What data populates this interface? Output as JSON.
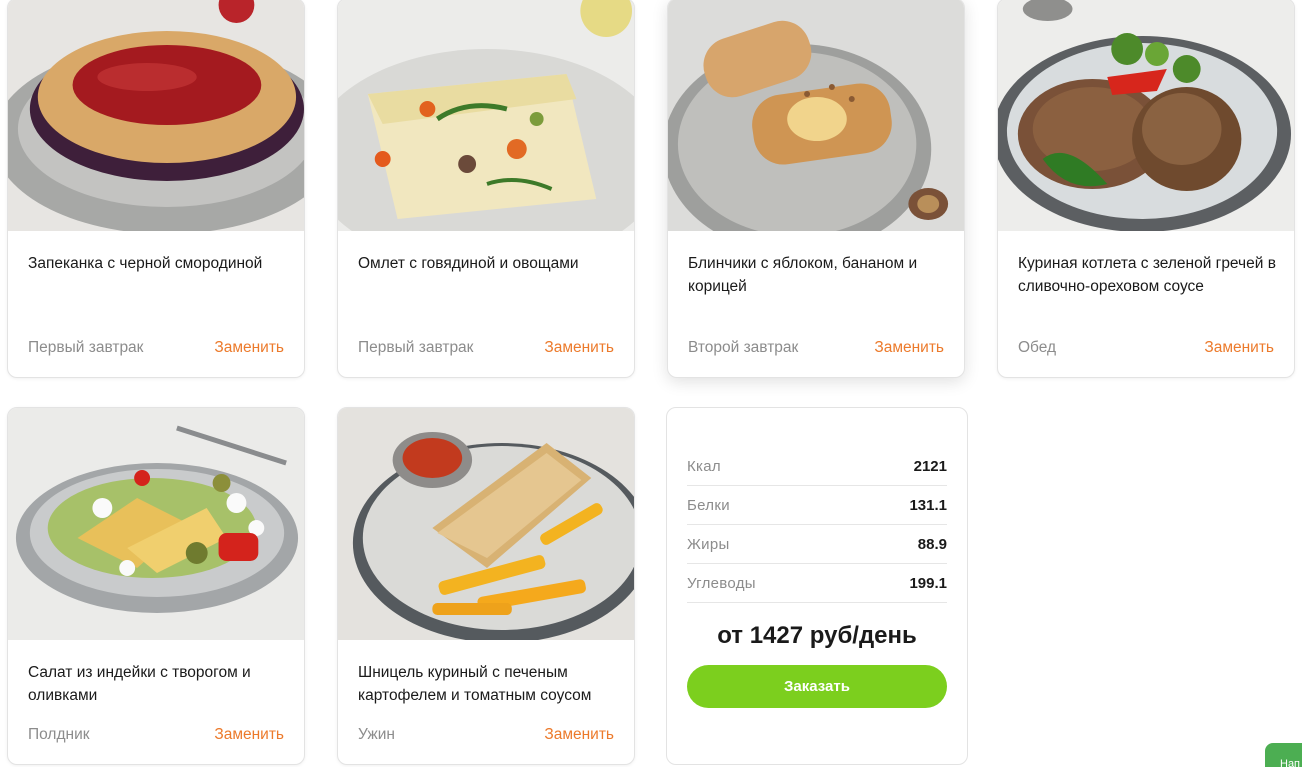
{
  "colors": {
    "accent_orange": "#ec7a2b",
    "button_green": "#7ccf1e",
    "muted_text": "#8c8c8c",
    "help_tab_green": "#4cae52"
  },
  "meals": [
    {
      "title": "Запеканка с черной смородиной",
      "meal": "Первый завтрак",
      "action": "Заменить",
      "image": "casserole-photo"
    },
    {
      "title": "Омлет с говядиной и овощами",
      "meal": "Первый завтрак",
      "action": "Заменить",
      "image": "omelette-photo"
    },
    {
      "title": "Блинчики с яблоком, бананом и корицей",
      "meal": "Второй завтрак",
      "action": "Заменить",
      "image": "pancakes-photo"
    },
    {
      "title": "Куриная котлета с зеленой гречей в сливочно-ореховом соусе",
      "meal": "Обед",
      "action": "Заменить",
      "image": "cutlet-photo"
    },
    {
      "title": "Салат из индейки с творогом и оливками",
      "meal": "Полдник",
      "action": "Заменить",
      "image": "salad-photo"
    },
    {
      "title": "Шницель куриный с печеным картофелем и томатным соусом",
      "meal": "Ужин",
      "action": "Заменить",
      "image": "schnitzel-photo"
    }
  ],
  "nutrition": [
    {
      "label": "Ккал",
      "value": "2121"
    },
    {
      "label": "Белки",
      "value": "131.1"
    },
    {
      "label": "Жиры",
      "value": "88.9"
    },
    {
      "label": "Углеводы",
      "value": "199.1"
    }
  ],
  "price_text": "от 1427 руб/день",
  "order_button_label": "Заказать",
  "help_tab_label": "Нап"
}
